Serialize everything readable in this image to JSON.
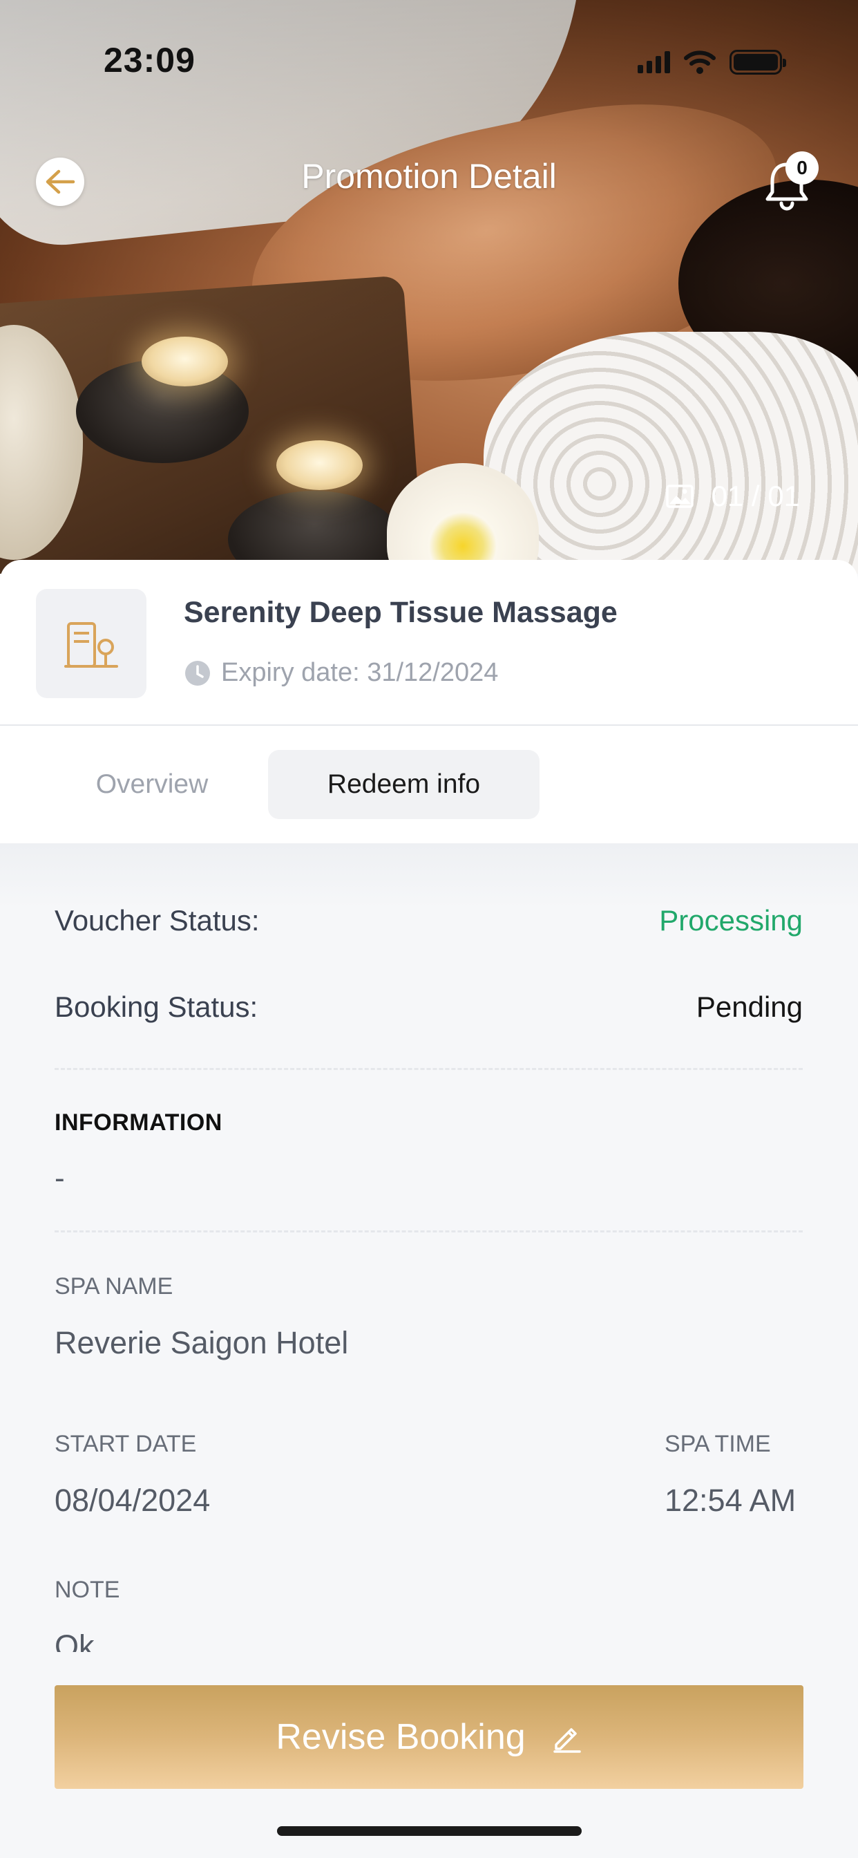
{
  "status_bar": {
    "time": "23:09"
  },
  "header": {
    "title": "Promotion Detail",
    "notification_count": "0",
    "image_counter": "01 / 01"
  },
  "product": {
    "name": "Serenity Deep Tissue Massage",
    "expiry": "Expiry date: 31/12/2024"
  },
  "tabs": [
    {
      "label": "Overview",
      "active": false
    },
    {
      "label": "Redeem info",
      "active": true
    }
  ],
  "redeem": {
    "voucher_status_label": "Voucher Status:",
    "voucher_status_value": "Processing",
    "booking_status_label": "Booking Status:",
    "booking_status_value": "Pending",
    "information_heading": "INFORMATION",
    "information_value": "-",
    "spa_name_label": "SPA NAME",
    "spa_name_value": "Reverie Saigon Hotel",
    "start_date_label": "START DATE",
    "start_date_value": "08/04/2024",
    "spa_time_label": "SPA TIME",
    "spa_time_value": "12:54 AM",
    "note_label": "NOTE",
    "note_value": "Ok"
  },
  "actions": {
    "revise_label": "Revise Booking"
  },
  "colors": {
    "accent_gold": "#c9a25f",
    "status_green": "#21a86b"
  },
  "icons": [
    "back-arrow-icon",
    "bell-icon",
    "image-icon",
    "building-icon",
    "clock-icon",
    "pencil-icon"
  ]
}
